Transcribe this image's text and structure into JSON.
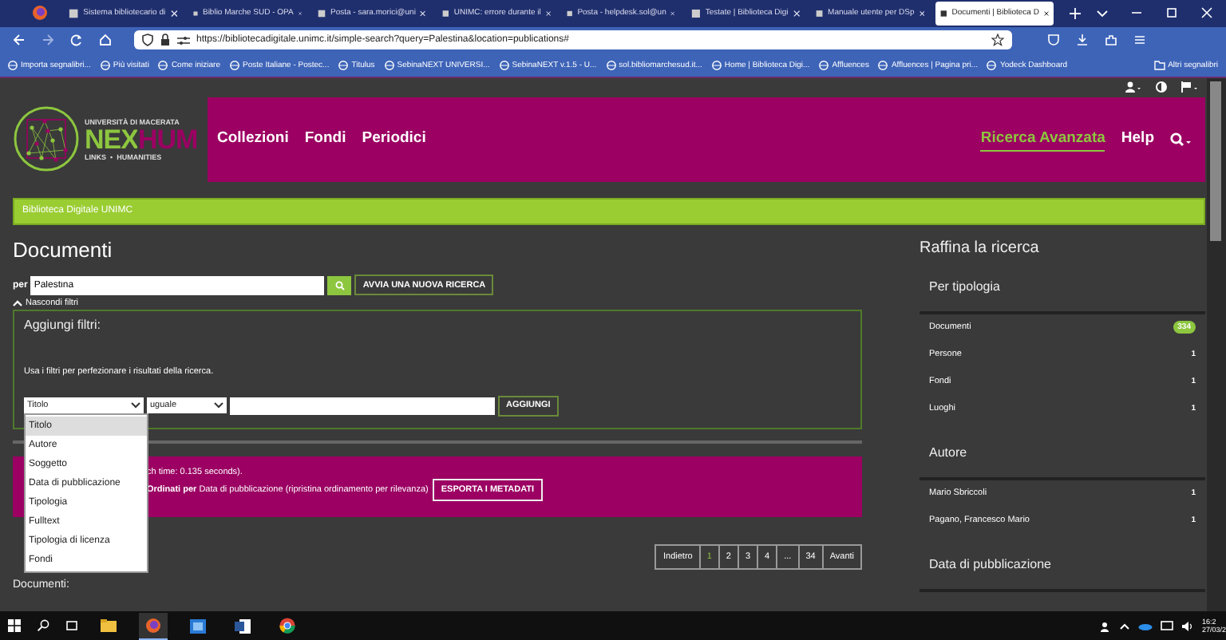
{
  "browser": {
    "tabs": [
      {
        "label": "Sistema bibliotecario di",
        "selected": false
      },
      {
        "label": "Biblio Marche SUD - OPA",
        "selected": false
      },
      {
        "label": "Posta - sara.morici@uni",
        "selected": false
      },
      {
        "label": "UNIMC: errore durante il",
        "selected": false
      },
      {
        "label": "Posta - helpdesk.sol@un",
        "selected": false
      },
      {
        "label": "Testate | Biblioteca Digi",
        "selected": false
      },
      {
        "label": "Manuale utente per DSp",
        "selected": false
      },
      {
        "label": "Documenti | Biblioteca D",
        "selected": true
      }
    ],
    "url": "https://bibliotecadigitale.unimc.it/simple-search?query=Palestina&location=publications#",
    "bookmarks": [
      "Importa segnalibri...",
      "Più visitati",
      "Come iniziare",
      "Poste Italiane - Postec...",
      "Titulus",
      "SebinaNEXT UNIVERSI...",
      "SebinaNEXT v.1.5 - U...",
      "sol.bibliomarchesud.it...",
      "Home | Biblioteca Digi...",
      "Affluences",
      "Affluences | Pagina pri...",
      "Yodeck Dashboard"
    ],
    "more_bookmarks": "Altri segnalibri"
  },
  "site": {
    "logo": {
      "university": "UNIVERSITÀ DI MACERATA",
      "name_first": "NEX",
      "name_second": "HUM",
      "tagline": "LINKS  •  HUMANITIES"
    },
    "nav": [
      {
        "label": "Collezioni",
        "selected": false
      },
      {
        "label": "Fondi",
        "selected": false
      },
      {
        "label": "Periodici",
        "selected": false
      }
    ],
    "nav_right": [
      {
        "label": "Ricerca Avanzata",
        "selected": true
      },
      {
        "label": "Help",
        "selected": false
      }
    ]
  },
  "breadcrumb": "Biblioteca Digitale UNIMC",
  "title": "Documenti",
  "search": {
    "prefix": "per",
    "value": "Palestina",
    "button": "AVVIA UNA NUOVA RICERCA"
  },
  "toggle_filters": "Nascondi filtri",
  "filters": {
    "title": "Aggiungi filtri:",
    "hint": "Usa i filtri per perfezionare i risultati della ricerca.",
    "field": "Titolo",
    "operator": "uguale",
    "button": "AGGIUNGI",
    "options": [
      {
        "label": "Titolo",
        "selected": true
      },
      {
        "label": "Autore",
        "selected": false
      },
      {
        "label": "Soggetto",
        "selected": false
      },
      {
        "label": "Data di pubblicazione",
        "selected": false
      },
      {
        "label": "Tipologia",
        "selected": false
      },
      {
        "label": "Fulltext",
        "selected": false
      },
      {
        "label": "Tipologia di licenza",
        "selected": false
      },
      {
        "label": "Fondi",
        "selected": false
      }
    ]
  },
  "results_bar": {
    "time": "ch time: 0.135 seconds).",
    "sort": "**Ordinati per** Data di pubblicazione (ripristina ordinamento per rilevanza)",
    "export": "ESPORTA I METADATI"
  },
  "pagination": [
    {
      "label": "Indietro",
      "selected": false
    },
    {
      "label": "1",
      "selected": true
    },
    {
      "label": "2",
      "selected": false
    },
    {
      "label": "3",
      "selected": false
    },
    {
      "label": "4",
      "selected": false
    },
    {
      "label": "...",
      "selected": false
    },
    {
      "label": "34",
      "selected": false
    },
    {
      "label": "Avanti",
      "selected": false
    }
  ],
  "list_title": "Documenti:",
  "refine": {
    "title": "Raffina la ricerca",
    "groups": [
      {
        "title": "Per tipologia",
        "items": [
          {
            "label": "Documenti",
            "count": "334",
            "selected": true
          },
          {
            "label": "Persone",
            "count": "1",
            "selected": false
          },
          {
            "label": "Fondi",
            "count": "1",
            "selected": false
          },
          {
            "label": "Luoghi",
            "count": "1",
            "selected": false
          }
        ]
      },
      {
        "title": "Autore",
        "items": [
          {
            "label": "Mario Sbriccoli",
            "count": "1",
            "selected": false
          },
          {
            "label": "Pagano, Francesco Mario",
            "count": "1",
            "selected": false
          }
        ]
      },
      {
        "title": "Data di pubblicazione"
      }
    ]
  },
  "taskbar": {
    "time": "16:2",
    "date": "27/03/2"
  }
}
